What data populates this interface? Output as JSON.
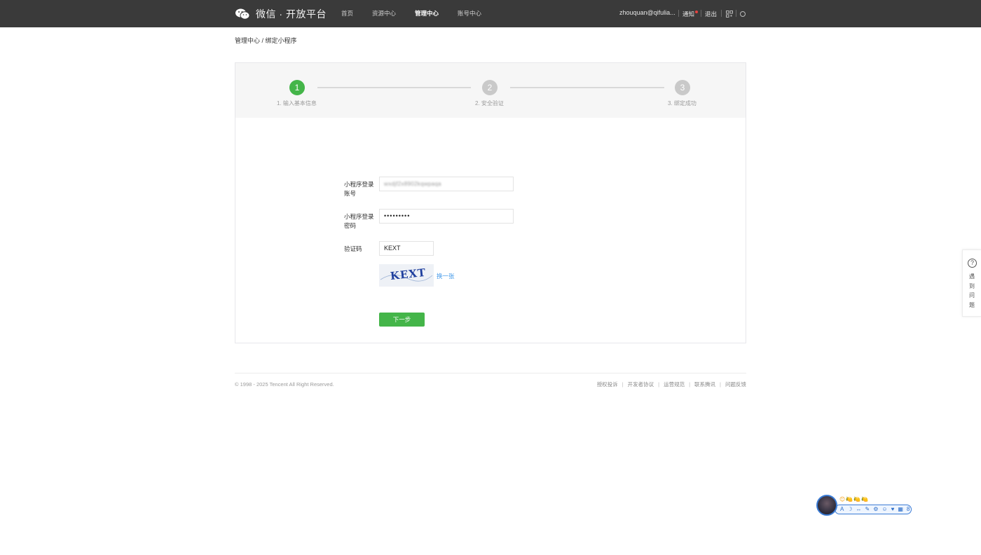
{
  "header": {
    "logo_text": "微信 · 开放平台",
    "nav": [
      "首页",
      "资源中心",
      "管理中心",
      "账号中心"
    ],
    "active_nav_index": 2,
    "user": "zhouquan@qifulia...",
    "notice": "通知",
    "logout": "退出"
  },
  "breadcrumb": "管理中心 / 绑定小程序",
  "steps": [
    {
      "number": "1",
      "label": "1. 输入基本信息",
      "state": "current"
    },
    {
      "number": "2",
      "label": "2. 安全验证",
      "state": "pending"
    },
    {
      "number": "3",
      "label": "3. 绑定成功",
      "state": "pending"
    }
  ],
  "form": {
    "account_label": "小程序登录账号",
    "account_value": "wxdjf2x8902kqwpaqa",
    "password_label": "小程序登录密码",
    "password_value": "•••••••••",
    "captcha_label": "验证码",
    "captcha_value": "KEXT",
    "captcha_image_text": "KEXT",
    "change_link": "换一张",
    "next_button": "下一步"
  },
  "footer": {
    "copyright": "© 1998 - 2025 Tencent All Right Reserved.",
    "links": [
      "授权投诉",
      "开发者协议",
      "运营规范",
      "联系腾讯",
      "问题反馈"
    ]
  },
  "help": {
    "icon": "?",
    "text": "遇到问题"
  },
  "widget": {
    "emojis": "😊🍋🍋🍋",
    "tools": [
      "A",
      "☽",
      "↔",
      "✎",
      "⚙",
      "☺",
      "♥",
      "▦",
      "8"
    ]
  },
  "colors": {
    "topbar": "#3a3a3a",
    "accent_green": "#44b549",
    "link_blue": "#459ae9"
  }
}
